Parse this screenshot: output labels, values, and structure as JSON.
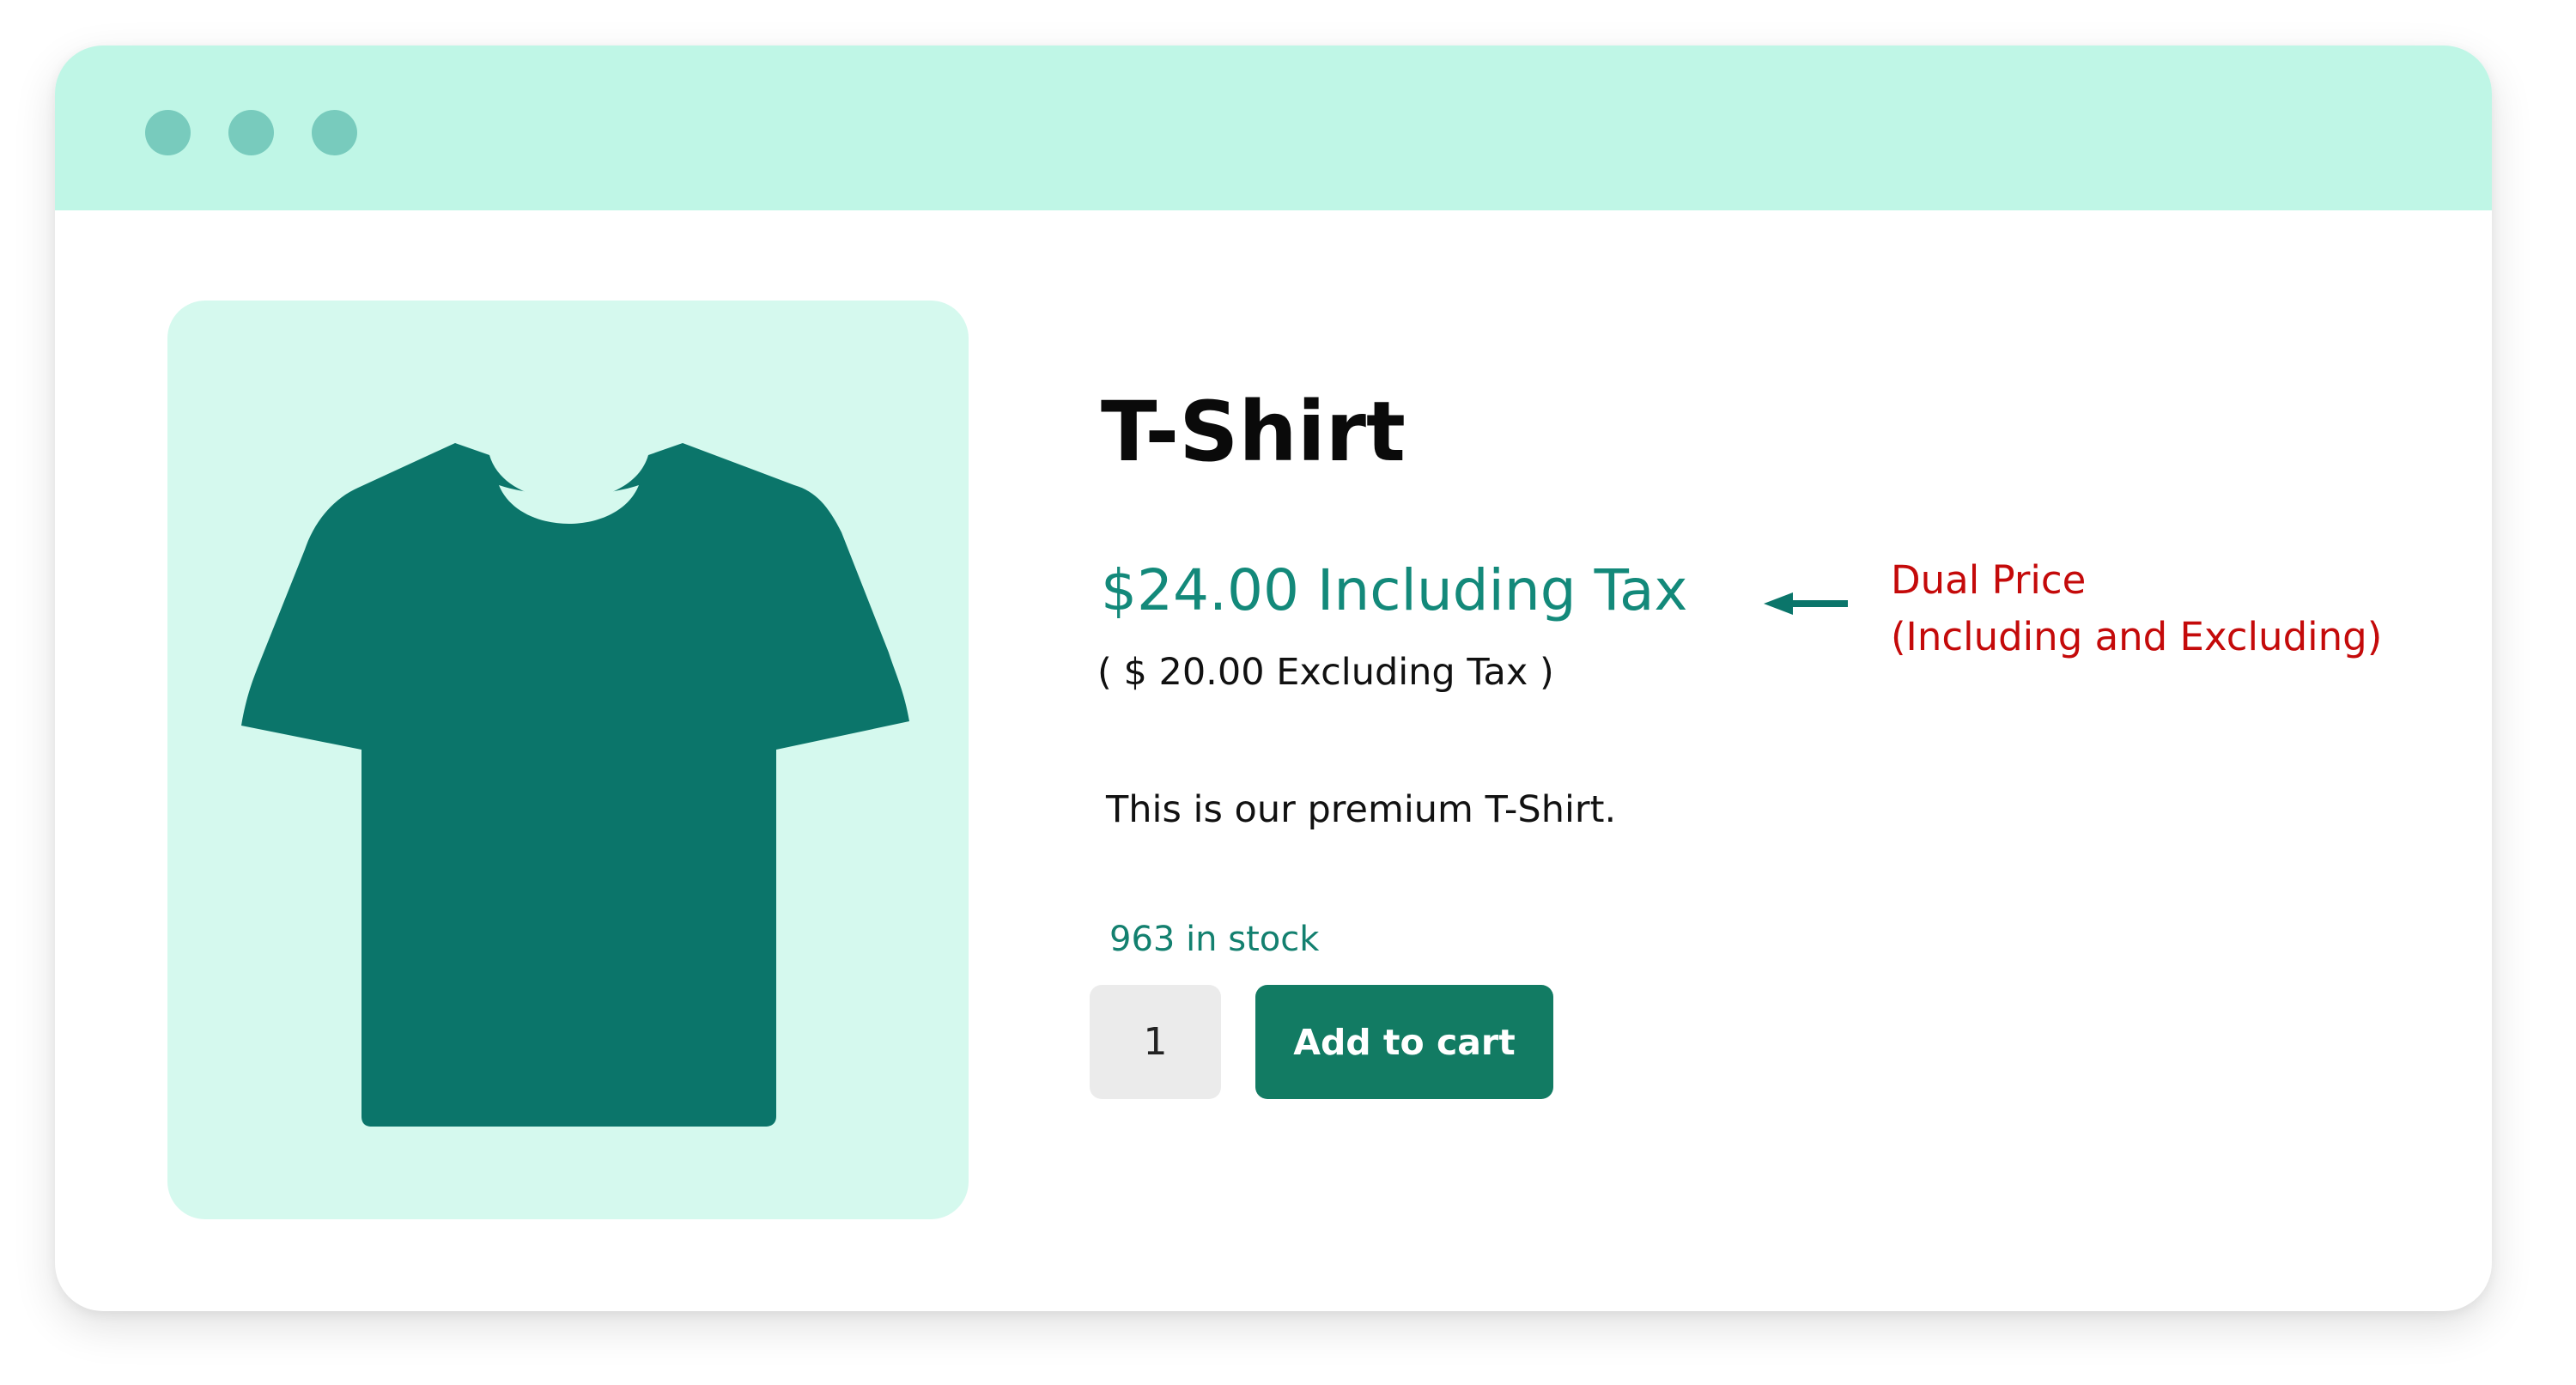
{
  "window": {
    "dots": [
      "window-dot",
      "window-dot",
      "window-dot"
    ],
    "colors": {
      "titlebar": "#bff6e6",
      "dot": "#78cbbd"
    }
  },
  "product": {
    "image_icon": "t-shirt-icon",
    "title": "T-Shirt",
    "price_including": "$24.00 Including Tax",
    "price_excluding": "( $ 20.00 Excluding Tax )",
    "description": "This is our premium T-Shirt.",
    "stock": "963 in stock",
    "quantity": "1",
    "add_to_cart_label": "Add to cart",
    "colors": {
      "image_bg": "#d5f9ee",
      "shirt": "#0b756a",
      "price": "#13897a",
      "stock": "#13806f",
      "button": "#127b63"
    }
  },
  "annotation": {
    "arrow_icon": "arrow-left-icon",
    "line1": "Dual Price",
    "line2": "(Including and Excluding)",
    "color": "#c40a0a"
  }
}
